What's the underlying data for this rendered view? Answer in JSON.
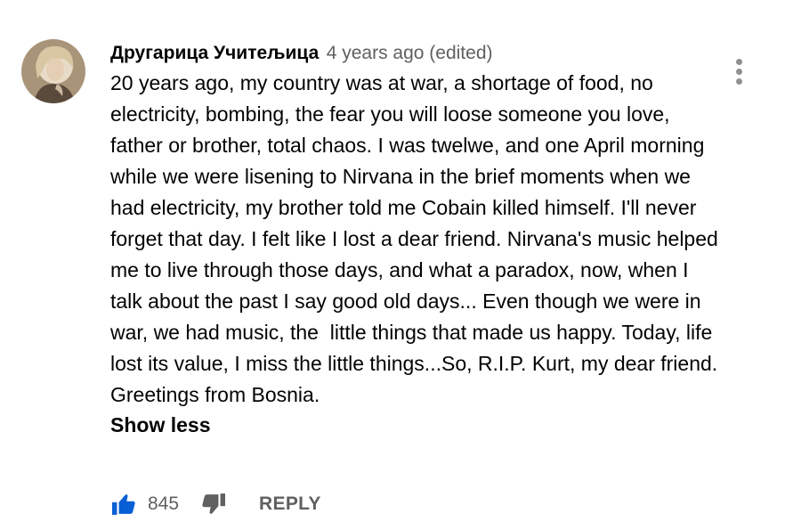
{
  "comment": {
    "author": "Другарица Учитељица",
    "time": "4 years ago (edited)",
    "text": "20 years ago, my country was at war, a shortage of food, no electricity, bombing, the fear you will loose someone you love, father or brother, total chaos. I was twelwe, and one April morning while we were lisening to Nirvana in the brief moments when we had electricity, my brother told me Cobain killed himself. I'll never forget that day. I felt like I lost a dear friend. Nirvana's music helped me to live through those days, and what a paradox, now, when I talk about the past I say good old days... Even though we were in war, we had music, the  little things that made us happy. Today, life lost its value, I miss the little things...So, R.I.P. Kurt, my dear friend. Greetings from Bosnia.",
    "show_less_label": "Show less",
    "like_count": "845",
    "reply_label": "REPLY"
  },
  "icons": {
    "avatar": "avatar",
    "menu": "more-vert-icon",
    "like": "thumb-up-icon",
    "dislike": "thumb-down-icon"
  },
  "colors": {
    "text_primary": "#030303",
    "text_secondary": "#606060",
    "like_active": "#065fd4",
    "icon_gray": "#909090"
  }
}
